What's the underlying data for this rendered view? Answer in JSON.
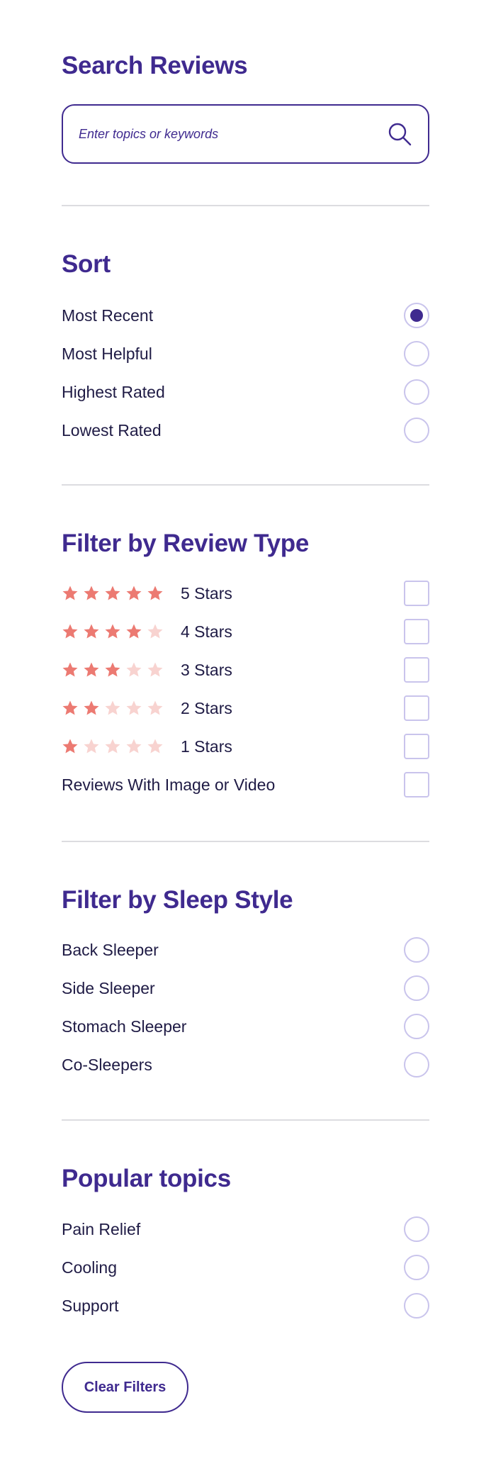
{
  "search": {
    "title": "Search Reviews",
    "placeholder": "Enter topics or keywords",
    "value": ""
  },
  "sort": {
    "title": "Sort",
    "selected": "Most Recent",
    "options": [
      "Most Recent",
      "Most Helpful",
      "Highest Rated",
      "Lowest Rated"
    ]
  },
  "review_type": {
    "title": "Filter by Review Type",
    "ratings": [
      {
        "label": "5 Stars",
        "stars": 5
      },
      {
        "label": "4 Stars",
        "stars": 4
      },
      {
        "label": "3 Stars",
        "stars": 3
      },
      {
        "label": "2 Stars",
        "stars": 2
      },
      {
        "label": "1 Stars",
        "stars": 1
      }
    ],
    "media_label": "Reviews With Image or Video"
  },
  "sleep_style": {
    "title": "Filter by Sleep Style",
    "options": [
      "Back Sleeper",
      "Side Sleeper",
      "Stomach Sleeper",
      "Co-Sleepers"
    ]
  },
  "topics": {
    "title": "Popular topics",
    "options": [
      "Pain Relief",
      "Cooling",
      "Support"
    ]
  },
  "clear_label": "Clear Filters",
  "colors": {
    "accent": "#3f2a8f",
    "text": "#1f1b45",
    "star_filled": "#ec7a72",
    "star_empty": "#f8d3d0",
    "control_border": "#c9c4ec",
    "divider": "#dcdce0"
  }
}
